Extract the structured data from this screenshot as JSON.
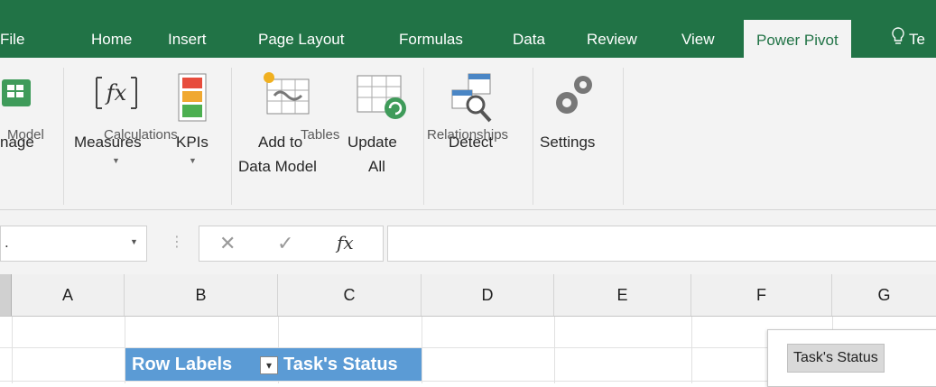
{
  "tabs": [
    {
      "label": "File"
    },
    {
      "label": "Home"
    },
    {
      "label": "Insert"
    },
    {
      "label": "Page Layout"
    },
    {
      "label": "Formulas"
    },
    {
      "label": "Data"
    },
    {
      "label": "Review"
    },
    {
      "label": "View"
    },
    {
      "label": "Power Pivot"
    },
    {
      "label": "Te"
    }
  ],
  "ribbon": {
    "manage": "nage",
    "measures": "Measures",
    "kpis": "KPIs",
    "add_line1": "Add to",
    "add_line2": "Data Model",
    "update_line1": "Update",
    "update_line2": "All",
    "detect": "Detect",
    "settings": "Settings",
    "groups": {
      "model": "Model",
      "calculations": "Calculations",
      "tables": "Tables",
      "relationships": "Relationships"
    }
  },
  "formula_bar": {
    "namebox_value": ".",
    "cancel_glyph": "✕",
    "enter_glyph": "✓",
    "fx_label": "fx",
    "value": ""
  },
  "columns": [
    "A",
    "B",
    "C",
    "D",
    "E",
    "F",
    "G"
  ],
  "pivot": {
    "row_labels": "Row Labels",
    "task_status_header": "Task's Status",
    "filter_glyph": "▾"
  },
  "slicer": {
    "title": "Task's Status"
  },
  "colors": {
    "tab_bar": "#217346",
    "ribbon_bg": "#f3f3f3",
    "pivot_header": "#5b9bd5"
  }
}
